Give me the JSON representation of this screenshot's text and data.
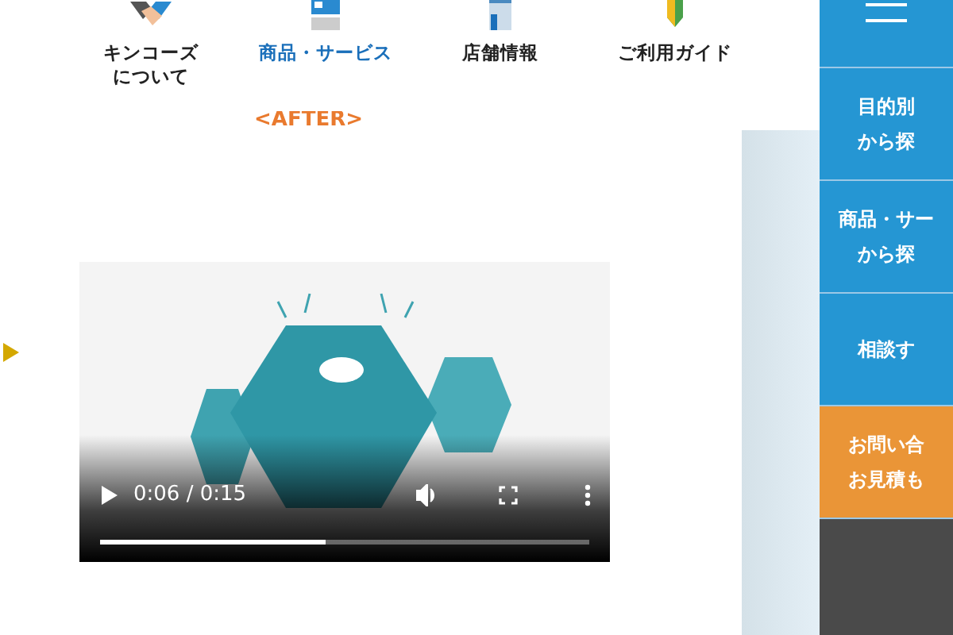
{
  "nav": [
    {
      "lines": [
        "キンコーズ",
        "について"
      ],
      "selected": false
    },
    {
      "lines": [
        "商品・サービス"
      ],
      "selected": true
    },
    {
      "lines": [
        "店舗情報"
      ],
      "selected": false
    },
    {
      "lines": [
        "ご利用ガイド"
      ],
      "selected": false
    }
  ],
  "heading": "<AFTER>",
  "video": {
    "kind": "picture",
    "time": "0:06 / 0:15",
    "level": 0.46
  },
  "side_menu": [
    {
      "lines": [
        "目的別",
        "から探"
      ],
      "kind": "blue"
    },
    {
      "lines": [
        "商品・サー",
        "から探"
      ],
      "kind": "blue"
    },
    {
      "lines": [
        "相談す"
      ],
      "kind": "blue"
    },
    {
      "lines": [
        "お問い合",
        "お見積も"
      ],
      "kind": "orange"
    }
  ]
}
